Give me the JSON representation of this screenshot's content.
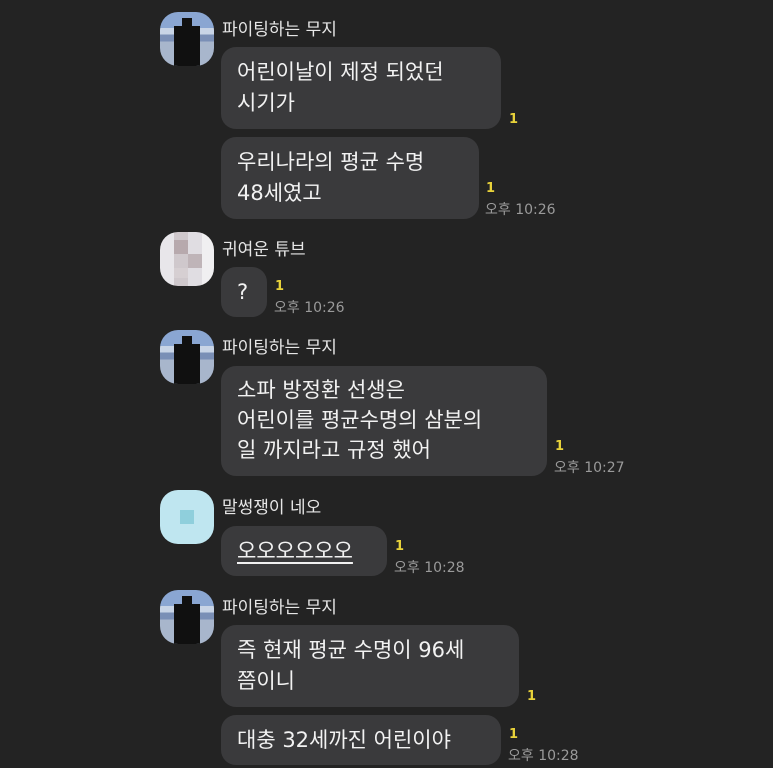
{
  "messages": [
    {
      "sender": "파이팅하는 무지",
      "bubbles": [
        {
          "lines": [
            "어린이날이 제정 되었던",
            "시기가"
          ],
          "unread": "1"
        },
        {
          "lines": [
            "우리나라의 평균 수명",
            "48세였고"
          ],
          "unread": "1",
          "time": "오후 10:26"
        }
      ]
    },
    {
      "sender": "귀여운 튜브",
      "bubbles": [
        {
          "lines": [
            "?"
          ],
          "unread": "1",
          "time": "오후 10:26"
        }
      ]
    },
    {
      "sender": "파이팅하는 무지",
      "bubbles": [
        {
          "lines": [
            "소파 방정환 선생은",
            "어린이를 평균수명의 삼분의",
            "일 까지라고 규정 했어"
          ],
          "unread": "1",
          "time": "오후 10:27"
        }
      ]
    },
    {
      "sender": "말썽쟁이 네오",
      "bubbles": [
        {
          "lines": [
            "오오오오오오"
          ],
          "unread": "1",
          "time": "오후 10:28"
        }
      ]
    },
    {
      "sender": "파이팅하는 무지",
      "bubbles": [
        {
          "lines": [
            "즉 현재 평균 수명이 96세",
            "쯤이니"
          ],
          "unread": "1"
        },
        {
          "lines": [
            "대충 32세까진 어린이야"
          ],
          "unread": "1",
          "time": "오후 10:28"
        }
      ]
    }
  ]
}
